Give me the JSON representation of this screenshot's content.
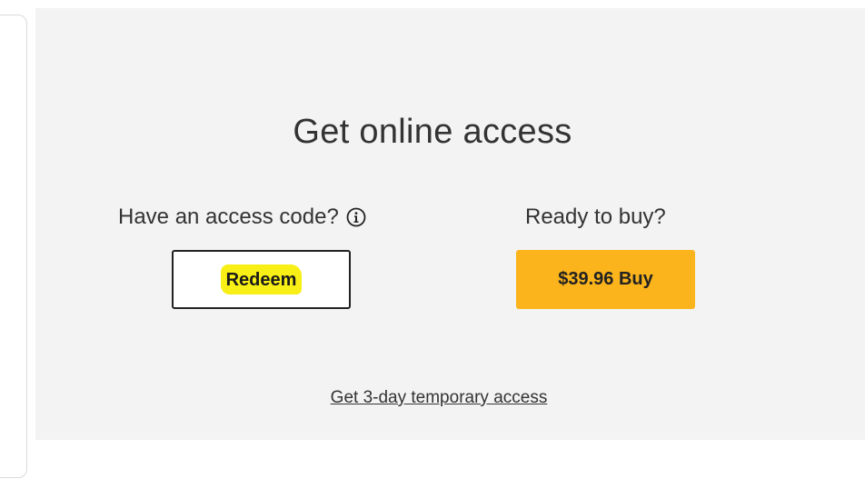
{
  "access": {
    "title": "Get online access",
    "redeem_prompt": "Have an access code?",
    "redeem_button": "Redeem",
    "buy_prompt": "Ready to buy?",
    "buy_button": "$39.96 Buy",
    "temporary_link": "Get 3-day temporary access"
  },
  "icons": {
    "info": "info-icon"
  },
  "colors": {
    "panel_background": "#f3f3f3",
    "buy_button": "#fbb41c",
    "redeem_highlight": "#f7ef15"
  }
}
